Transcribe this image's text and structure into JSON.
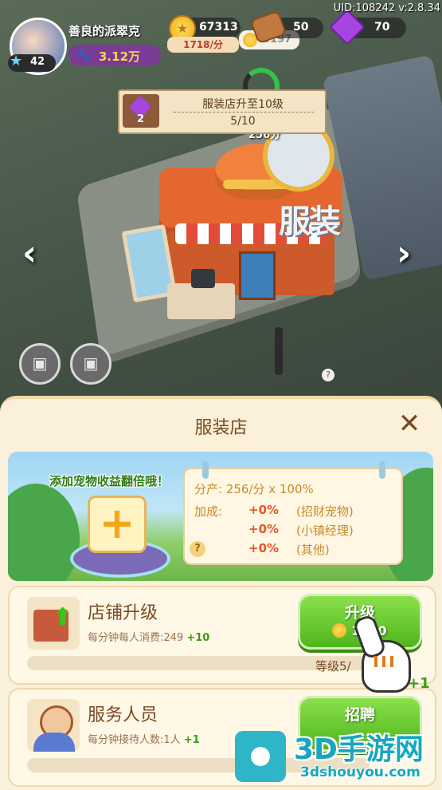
{
  "hud": {
    "player_name": "善良的派翠克",
    "pet_income": "3.12万",
    "level": "42",
    "coins": "67313",
    "coin_rate": "1718/分",
    "wood": "50",
    "gems": "70",
    "uid": "UID:108242 v:2.8.34",
    "bubble_coins": "5197",
    "float_income": "256分"
  },
  "task": {
    "reward": "2",
    "title": "服装店升至10级",
    "progress": "5/10"
  },
  "scene": {
    "shop_sign": "服装"
  },
  "panel": {
    "title": "服装店",
    "pet_banner_text": "添加宠物收益翻倍哦！",
    "output_line": "分产: 256/分 x 100%",
    "bonus_label": "加成:",
    "bonuses": [
      {
        "pct": "+0%",
        "name": "(招财宠物)"
      },
      {
        "pct": "+0%",
        "name": "(小镇经理)"
      },
      {
        "pct": "+0%",
        "name": "(其他)"
      }
    ]
  },
  "upgrade": {
    "title": "店铺升级",
    "desc": "每分钟每人消费:249",
    "delta": "+10",
    "button": "升级",
    "cost": "1000",
    "level": "等级5/"
  },
  "staff": {
    "title": "服务人员",
    "desc": "每分钟接待人数:1人",
    "delta": "+1",
    "button": "招聘",
    "plus_badge": "+1"
  },
  "watermark": {
    "title": "3D手游网",
    "url": "3dshouyou.com"
  },
  "colors": {
    "panel_bg": "#fbf0d9",
    "button_green": "#4fb51d",
    "title_brown": "#7b4a24"
  }
}
